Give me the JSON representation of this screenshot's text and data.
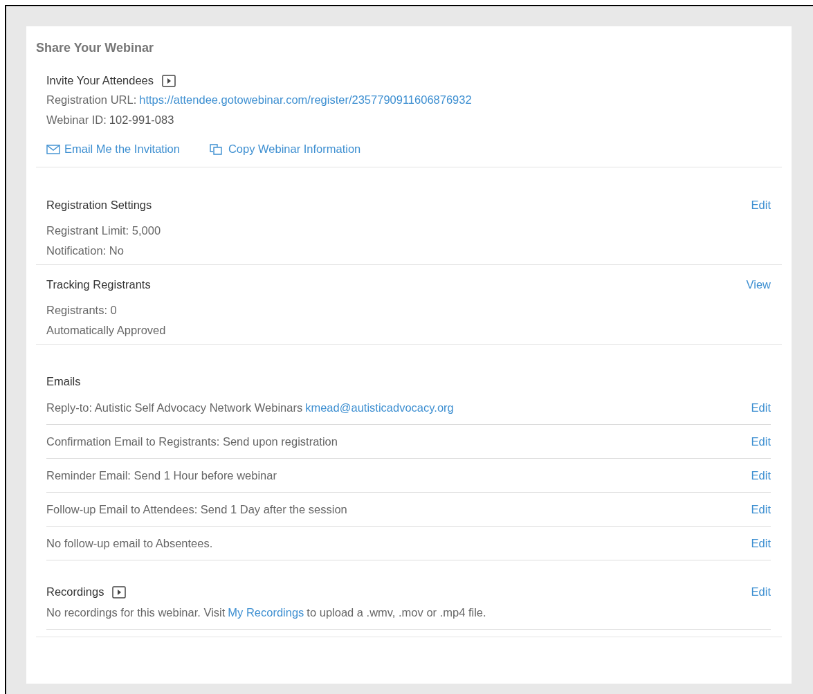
{
  "title": "Share Your Webinar",
  "invite": {
    "heading": "Invite Your Attendees",
    "lines": [
      {
        "kind": "link",
        "label": "Registration URL:",
        "value": "https://attendee.gotowebinar.com/register/2357790911606876932"
      },
      {
        "kind": "text",
        "label": "Webinar ID:",
        "value": "102-991-083"
      }
    ],
    "actions": [
      {
        "kind": "email",
        "label": "Email Me the Invitation"
      },
      {
        "kind": "copy",
        "label": "Copy Webinar Information"
      }
    ]
  },
  "registration_settings": {
    "heading": "Registration Settings",
    "action": "Edit",
    "lines": [
      "Registrant Limit: 5,000",
      "Notification: No"
    ]
  },
  "tracking_registrants": {
    "heading": "Tracking Registrants",
    "action": "View",
    "lines": [
      "Registrants: 0",
      "Automatically Approved"
    ]
  },
  "emails": {
    "heading": "Emails",
    "rows": [
      {
        "text": "Reply-to: Autistic Self Advocacy Network Webinars",
        "link": "kmead@autisticadvocacy.org",
        "action": "Edit"
      },
      {
        "text": "Confirmation Email to Registrants: Send upon registration",
        "action": "Edit"
      },
      {
        "text": "Reminder Email: Send 1 Hour before webinar",
        "action": "Edit"
      },
      {
        "text": "Follow-up Email to Attendees: Send 1 Day after the session",
        "action": "Edit"
      },
      {
        "text": "No follow-up email to Absentees.",
        "action": "Edit"
      }
    ]
  },
  "recordings": {
    "heading": "Recordings",
    "action": "Edit",
    "text_before": "No recordings for this webinar. Visit",
    "link": "My Recordings",
    "text_after": "to upload a .wmv, .mov or .mp4 file."
  }
}
